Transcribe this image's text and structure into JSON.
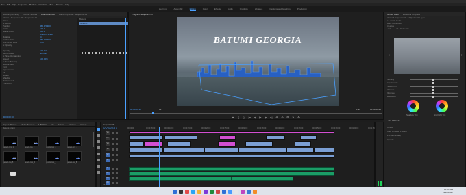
{
  "menu": [
    "File",
    "Edit",
    "Clip",
    "Sequence",
    "Markers",
    "Graphics",
    "View",
    "Window",
    "Help"
  ],
  "workspaces": [
    "Learning",
    "Assembly",
    "Editing",
    "Color",
    "Effects",
    "Audio",
    "Graphics",
    "Libraries",
    "Captions and Graphics",
    "Production"
  ],
  "workspace_active": "Editing",
  "effect_controls": {
    "tabs": [
      "Source: (no clips)",
      "Lumetri Scopes",
      "Effect Controls",
      "Audio Clip Mixer: Sequence 01"
    ],
    "active_tab": "Effect Controls",
    "header": "Master * Sequence 01 • Sequence 01",
    "rows": [
      {
        "label": "Video",
        "val": ""
      },
      {
        "label": "fx Motion",
        "val": ""
      },
      {
        "label": "Position",
        "val": "960.0   540.0"
      },
      {
        "label": "Scale",
        "val": "100.0"
      },
      {
        "label": "Scale Width",
        "val": "100.0"
      },
      {
        "label": "",
        "val": "Uniform Scale"
      },
      {
        "label": "Rotation",
        "val": "0.0"
      },
      {
        "label": "Anchor Point",
        "val": "960.0   540.0"
      },
      {
        "label": "Anti-flicker Filter",
        "val": "0.00"
      },
      {
        "label": "fx Opacity",
        "val": ""
      },
      {
        "label": "",
        "val": ""
      },
      {
        "label": "Opacity",
        "val": "100.0 %"
      },
      {
        "label": "Blend Mode",
        "val": "Normal"
      },
      {
        "label": "fx Time Remapping",
        "val": ""
      },
      {
        "label": "Speed",
        "val": "100.00%"
      },
      {
        "label": "fx Text (Batumi)",
        "val": ""
      },
      {
        "label": "Source Text",
        "val": ""
      },
      {
        "label": "Font",
        "val": ""
      },
      {
        "label": "Appearance",
        "val": ""
      },
      {
        "label": "Fill",
        "val": ""
      },
      {
        "label": "Stroke",
        "val": ""
      },
      {
        "label": "Shadow",
        "val": ""
      },
      {
        "label": "Background",
        "val": ""
      },
      {
        "label": "Transform",
        "val": ""
      }
    ],
    "timecode": "00:00:03:10"
  },
  "mini_timeline": {
    "label": "Batumi",
    "clip": "Graphic"
  },
  "program": {
    "label": "Program: Sequence 01",
    "title_text": "BATUMI GEORGIA",
    "timecode_left": "00:00:03:10",
    "fit": "Fit",
    "quality": "Full",
    "timecode_right": "00:00:53:23"
  },
  "lumetri": {
    "tabs": [
      "Lumetri Color",
      "Essential Graphics"
    ],
    "active_tab": "Lumetri Color",
    "header": "Master * Sequence 01 • Adjustment Layer",
    "fx_label": "fx Lumetri Color",
    "sections": [
      "Basic Correction",
      "Creative",
      "Look",
      "Curves",
      "Color Wheels & Match",
      "HSL Secondary",
      "Vignette"
    ],
    "look": "SL BLUE ICE",
    "controls": [
      "Intensity",
      "Adjustments",
      "Faded Film",
      "Sharpen",
      "Vibrance",
      "Saturation"
    ],
    "shadow_tint": "Shadow Tint",
    "highlight_tint": "Highlight Tint",
    "tint_balance": "Tint Balance"
  },
  "project": {
    "tabs": [
      "Project: Batumi",
      "Media Browser",
      "Libraries",
      "Info",
      "Effects",
      "Markers",
      "History"
    ],
    "active_tab": "Libraries",
    "label": "Batumi.prproj",
    "items": [
      "pexels-mm_1",
      "pexels-ma_2",
      "pexels-mm_3",
      "pexels-mm_4",
      "pexels-ma_5",
      "pexels-mm_6",
      "pexels-mm_7",
      "pexels-ma_8"
    ],
    "durations": [
      "0:11",
      "0:07",
      "0:15",
      "0:09",
      "0:13",
      "0:10",
      "0:08",
      "0:12"
    ]
  },
  "timeline": {
    "label": "Sequence 01",
    "timecode": "00:00:03:10",
    "ruler": [
      "00:00:00",
      "00:00:05:00",
      "00:00:10:00",
      "00:00:15:00",
      "00:00:20:00",
      "00:00:25:00",
      "00:00:30:00",
      "00:00:35:00",
      "00:00:40:00",
      "00:00:45:00",
      "00:00:50:00",
      "00:00:55:00",
      "00:01:00:00",
      "00:01:05:00"
    ],
    "video_tracks": [
      "V6",
      "V5",
      "V4",
      "V3",
      "V2",
      "V1"
    ],
    "audio_tracks": [
      "A1",
      "A2",
      "A3",
      "A4"
    ],
    "mix": "Mix"
  },
  "taskbar": {
    "time": "12:34 PM",
    "date": "11/24/2022"
  }
}
